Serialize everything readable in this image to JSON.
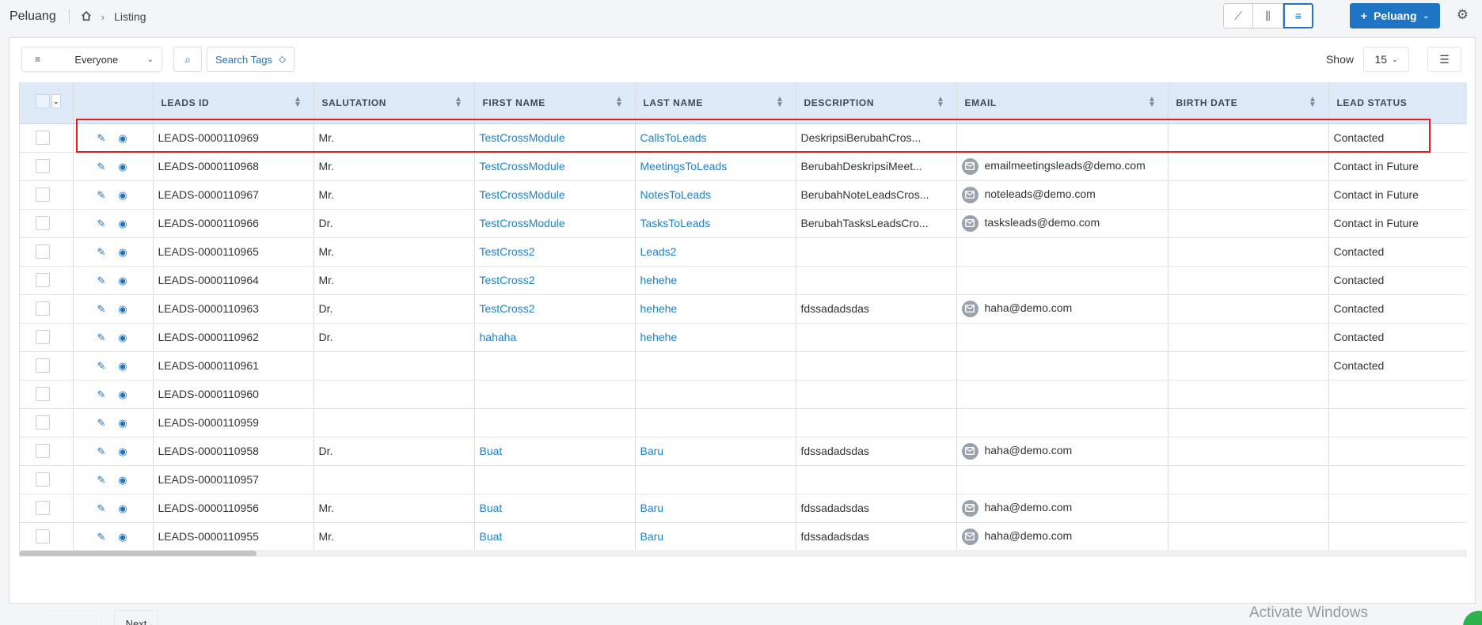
{
  "header": {
    "app_title": "Peluang",
    "breadcrumb_page": "Listing",
    "new_button_label": "Peluang",
    "view_icons": [
      "chart-line-icon",
      "kanban-icon",
      "list-icon"
    ]
  },
  "toolbar": {
    "owner_filter": "Everyone",
    "search_tags_label": "Search Tags",
    "show_label": "Show",
    "per_page": "15"
  },
  "columns": [
    "LEADS ID",
    "SALUTATION",
    "FIRST NAME",
    "LAST NAME",
    "DESCRIPTION",
    "EMAIL",
    "BIRTH DATE",
    "LEAD STATUS"
  ],
  "rows": [
    {
      "id": "LEADS-0000110969",
      "salutation": "Mr.",
      "first_name": "TestCrossModule",
      "last_name": "CallsToLeads",
      "description": "DeskripsiBerubahCros...",
      "email": "",
      "birth_date": "",
      "status": "Contacted"
    },
    {
      "id": "LEADS-0000110968",
      "salutation": "Mr.",
      "first_name": "TestCrossModule",
      "last_name": "MeetingsToLeads",
      "description": "BerubahDeskripsiMeet...",
      "email": "emailmeetingsleads@demo.com",
      "birth_date": "",
      "status": "Contact in Future"
    },
    {
      "id": "LEADS-0000110967",
      "salutation": "Mr.",
      "first_name": "TestCrossModule",
      "last_name": "NotesToLeads",
      "description": "BerubahNoteLeadsCros...",
      "email": "noteleads@demo.com",
      "birth_date": "",
      "status": "Contact in Future"
    },
    {
      "id": "LEADS-0000110966",
      "salutation": "Dr.",
      "first_name": "TestCrossModule",
      "last_name": "TasksToLeads",
      "description": "BerubahTasksLeadsCro...",
      "email": "tasksleads@demo.com",
      "birth_date": "",
      "status": "Contact in Future"
    },
    {
      "id": "LEADS-0000110965",
      "salutation": "Mr.",
      "first_name": "TestCross2",
      "last_name": "Leads2",
      "description": "",
      "email": "",
      "birth_date": "",
      "status": "Contacted"
    },
    {
      "id": "LEADS-0000110964",
      "salutation": "Mr.",
      "first_name": "TestCross2",
      "last_name": "hehehe",
      "description": "",
      "email": "",
      "birth_date": "",
      "status": "Contacted"
    },
    {
      "id": "LEADS-0000110963",
      "salutation": "Dr.",
      "first_name": "TestCross2",
      "last_name": "hehehe",
      "description": "fdssadadsdas",
      "email": "haha@demo.com",
      "birth_date": "",
      "status": "Contacted"
    },
    {
      "id": "LEADS-0000110962",
      "salutation": "Dr.",
      "first_name": "hahaha",
      "last_name": "hehehe",
      "description": "",
      "email": "",
      "birth_date": "",
      "status": "Contacted"
    },
    {
      "id": "LEADS-0000110961",
      "salutation": "",
      "first_name": "",
      "last_name": "",
      "description": "",
      "email": "",
      "birth_date": "",
      "status": "Contacted"
    },
    {
      "id": "LEADS-0000110960",
      "salutation": "",
      "first_name": "",
      "last_name": "",
      "description": "",
      "email": "",
      "birth_date": "",
      "status": ""
    },
    {
      "id": "LEADS-0000110959",
      "salutation": "",
      "first_name": "",
      "last_name": "",
      "description": "",
      "email": "",
      "birth_date": "",
      "status": ""
    },
    {
      "id": "LEADS-0000110958",
      "salutation": "Dr.",
      "first_name": "Buat",
      "last_name": "Baru",
      "description": "fdssadadsdas",
      "email": "haha@demo.com",
      "birth_date": "",
      "status": ""
    },
    {
      "id": "LEADS-0000110957",
      "salutation": "",
      "first_name": "",
      "last_name": "",
      "description": "",
      "email": "",
      "birth_date": "",
      "status": ""
    },
    {
      "id": "LEADS-0000110956",
      "salutation": "Mr.",
      "first_name": "Buat",
      "last_name": "Baru",
      "description": "fdssadadsdas",
      "email": "haha@demo.com",
      "birth_date": "",
      "status": ""
    },
    {
      "id": "LEADS-0000110955",
      "salutation": "Mr.",
      "first_name": "Buat",
      "last_name": "Baru",
      "description": "fdssadadsdas",
      "email": "haha@demo.com",
      "birth_date": "",
      "status": ""
    }
  ],
  "pager": {
    "next_label": "Next"
  },
  "watermark": "Activate Windows",
  "colors": {
    "accent": "#1f74c4",
    "header_bg": "#dde9f7",
    "highlight": "#e02020"
  }
}
